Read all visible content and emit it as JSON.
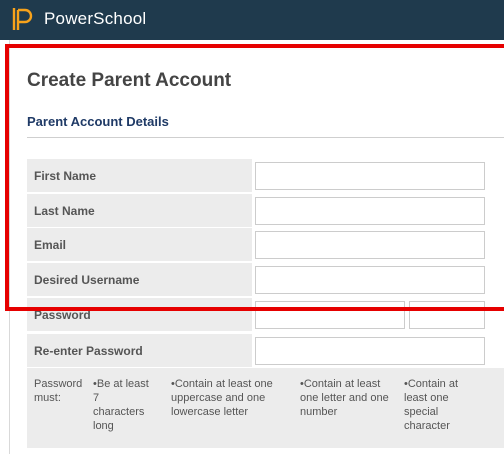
{
  "header": {
    "brand": "PowerSchool"
  },
  "page": {
    "title": "Create Parent Account",
    "section_title": "Parent Account Details"
  },
  "form": {
    "first_name_label": "First Name",
    "last_name_label": "Last Name",
    "email_label": "Email",
    "username_label": "Desired Username",
    "password_label": "Password",
    "reenter_password_label": "Re-enter Password",
    "first_name_value": "",
    "last_name_value": "",
    "email_value": "",
    "username_value": "",
    "password_value": "",
    "reenter_password_value": ""
  },
  "password_requirements": {
    "intro": "Password must:",
    "rules": [
      "•Be at least 7 characters long",
      "•Contain at least one uppercase and one lowercase letter",
      "•Contain at least one letter and one number",
      "•Contain at least one special character"
    ]
  },
  "colors": {
    "header_bg": "#1f3a4d",
    "label_bg": "#ececec",
    "section_title": "#1f3a66",
    "highlight": "#e60000"
  }
}
